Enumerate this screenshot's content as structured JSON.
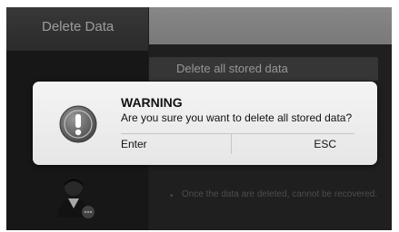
{
  "header": {
    "title": "Delete Data"
  },
  "action": {
    "label": "Delete all stored data"
  },
  "info": {
    "bullet": "•",
    "text": "Once the data are deleted, cannot be recovered."
  },
  "dialog": {
    "title": "WARNING",
    "message": "Are you sure you want to delete all stored data?",
    "buttons": {
      "enter": "Enter",
      "esc": "ESC"
    }
  },
  "icons": {
    "warning": "exclamation-icon",
    "avatar": "user-avatar-icon"
  },
  "colors": {
    "dialog_bg": "#f0f0f0",
    "screen_bg": "#262626",
    "header_accent": "#b4b4b4"
  }
}
